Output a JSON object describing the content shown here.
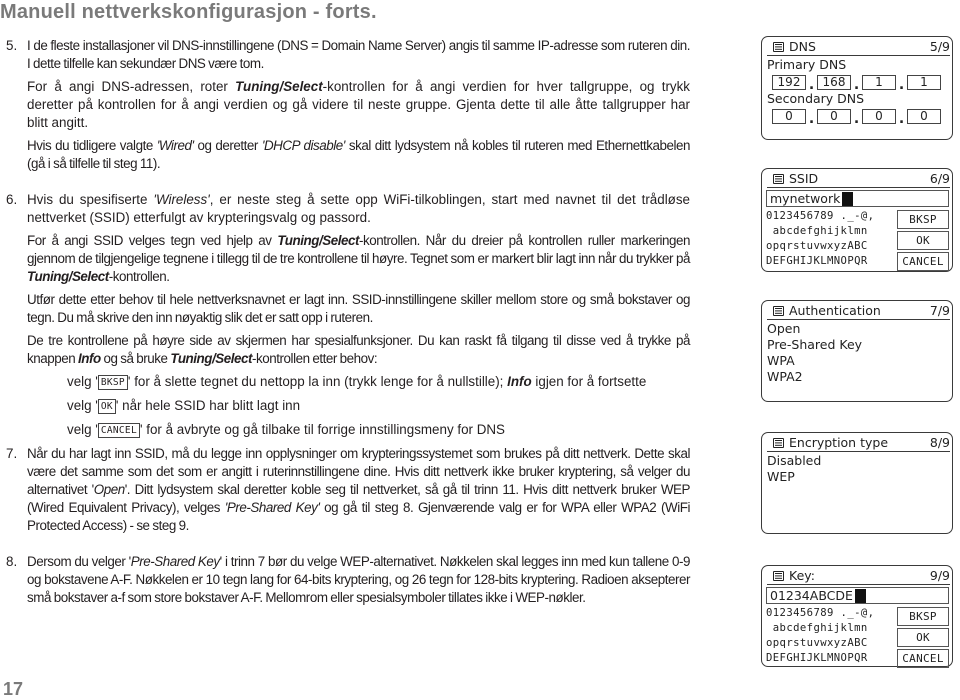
{
  "document": {
    "title": "Manuell nettverkskonfigurasjon - forts.",
    "page_number": "17"
  },
  "steps": {
    "step5": {
      "num": "5.",
      "p1": "I de fleste installasjoner vil DNS-innstillingene (DNS = Domain Name Server) angis til samme IP-adresse som ruteren din. I dette tilfelle kan sekundær DNS være tom.",
      "p2_a": "For å angi DNS-adressen, roter ",
      "p2_b": "Tuning/Select",
      "p2_c": "-kontrollen for å angi verdien for hver tallgruppe, og trykk deretter på kontrollen for å angi verdien og gå videre til neste gruppe. Gjenta dette til alle åtte tallgrupper har blitt angitt.",
      "p3_a": "Hvis du tidligere valgte ",
      "p3_b": "'Wired'",
      "p3_c": " og deretter ",
      "p3_d": "'DHCP disable'",
      "p3_e": " skal ditt lydsystem nå kobles til ruteren med Ethernettkabelen (gå i så tilfelle til steg 11)."
    },
    "step6": {
      "num": "6.",
      "p1_a": "Hvis du spesifiserte ",
      "p1_b": "'Wireless'",
      "p1_c": ", er neste steg å sette opp WiFi-tilkoblingen, start med navnet til det trådløse nettverket (SSID) etterfulgt av krypteringsvalg og passord.",
      "p2_a": "For å angi SSID velges tegn ved hjelp av ",
      "p2_b": "Tuning/Select",
      "p2_c": "-kontrollen. Når du dreier på kontrollen ruller markeringen gjennom de tilgjengelige tegnene i tillegg til de tre kontrollene til høyre. Tegnet som er markert blir lagt inn når du trykker på ",
      "p2_d": "Tuning/Select",
      "p2_e": "-kontrollen.",
      "p3": "Utfør dette etter behov til hele nettverksnavnet er lagt inn. SSID-innstillingene skiller mellom store og små bokstaver og tegn. Du må skrive den inn nøyaktig slik det er satt opp i ruteren.",
      "p4_a": "De tre kontrollene på høyre side av skjermen har spesialfunksjoner. Du kan raskt få tilgang til disse ved å trykke på knappen ",
      "p4_b": "Info",
      "p4_c": " og så bruke ",
      "p4_d": "Tuning/Select",
      "p4_e": "-kontrollen etter behov:",
      "sub1_a": "velg '",
      "sub1_btn": "BKSP",
      "sub1_b": "' for å slette tegnet du nettopp la inn (trykk lenge for å nullstille); ",
      "sub1_c": "Info",
      "sub1_d": " igjen for å fortsette",
      "sub2_a": "velg '",
      "sub2_btn": "OK",
      "sub2_b": "' når hele SSID har blitt lagt inn",
      "sub3_a": "velg '",
      "sub3_btn": "CANCEL",
      "sub3_b": "' for å avbryte og gå tilbake til forrige innstillingsmeny for DNS"
    },
    "step7": {
      "num": "7.",
      "p1_a": "Når du har lagt inn SSID, må du legge inn opplysninger om krypteringssystemet som brukes på ditt nettverk. Dette skal være det samme som det som er angitt i ruterinnstillingene dine. Hvis ditt nettverk ikke bruker kryptering, så velger du alternativet '",
      "p1_b": "Open",
      "p1_c": "'. Ditt lydsystem skal deretter koble seg til nettverket, så gå til trinn 11. Hvis ditt nettverk bruker WEP (Wired Equivalent Privacy), velges ",
      "p1_d": "'Pre-Shared Key'",
      "p1_e": " og gå til steg 8. Gjenværende valg er for WPA eller WPA2 (WiFi Protected Access) - se steg 9."
    },
    "step8": {
      "num": "8.",
      "p1_a": "Dersom du velger '",
      "p1_b": "Pre-Shared Key",
      "p1_c": "' i trinn 7 bør du velge WEP-alternativet. Nøkkelen skal legges inn med kun tallene 0-9 og bokstavene A-F. Nøkkelen er 10 tegn lang for 64-bits kryptering, og 26 tegn for 128-bits kryptering. Radioen aksepterer små bokstaver a-f som store bokstaver A-F. Mellomrom eller spesialsymboler tillates ikke i WEP-nøkler."
    }
  },
  "screens": {
    "dns": {
      "icon": "menu-icon",
      "title": "DNS",
      "page": "5/9",
      "primary_label": "Primary DNS",
      "primary_octets": [
        "192",
        "168",
        "1",
        "1"
      ],
      "secondary_label": "Secondary DNS",
      "secondary_octets": [
        "0",
        "0",
        "0",
        "0"
      ]
    },
    "ssid": {
      "icon": "menu-icon",
      "title": "SSID",
      "page": "6/9",
      "input_value": "mynetwork",
      "char_rows": [
        "0123456789 ._-@,",
        " abcdefghijklmn",
        "opqrstuvwxyzABC",
        "DEFGHIJKLMNOPQR"
      ],
      "buttons": [
        "BKSP",
        "OK",
        "CANCEL"
      ]
    },
    "authentication": {
      "icon": "menu-icon",
      "title": "Authentication",
      "page": "7/9",
      "options": [
        "Open",
        "Pre-Shared Key",
        "WPA",
        "WPA2"
      ]
    },
    "encryption": {
      "icon": "menu-icon",
      "title": "Encryption type",
      "page": "8/9",
      "options": [
        "Disabled",
        "WEP"
      ]
    },
    "key": {
      "icon": "menu-icon",
      "title": "Key:",
      "page": "9/9",
      "input_value": "01234ABCDE",
      "char_rows": [
        "0123456789 ._-@,",
        " abcdefghijklmn",
        "opqrstuvwxyzABC",
        "DEFGHIJKLMNOPQR"
      ],
      "buttons": [
        "BKSP",
        "OK",
        "CANCEL"
      ]
    }
  }
}
